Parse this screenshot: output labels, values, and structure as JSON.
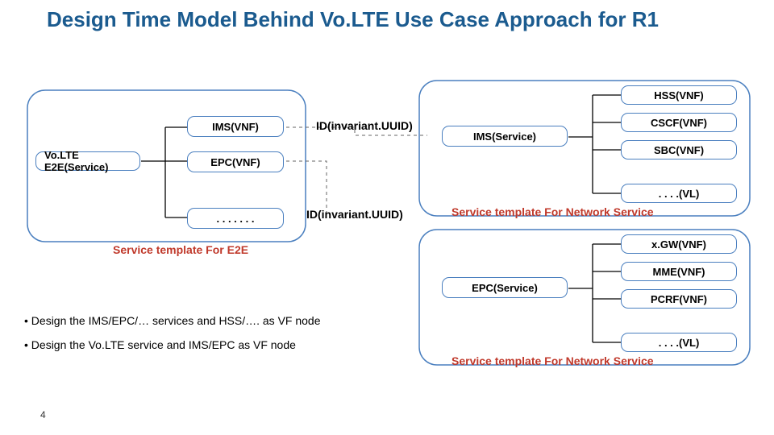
{
  "title": "Design Time Model Behind Vo.LTE Use Case Approach for R1",
  "left": {
    "volte": "Vo.LTE E2E(Service)",
    "ims_vnf": "IMS(VNF)",
    "epc_vnf": "EPC(VNF)",
    "dots": ". . . . . . .",
    "tmpl_e2e": "Service template For E2E"
  },
  "mid": {
    "id1": "ID(invariant.UUID)",
    "ims_service": "IMS(Service)",
    "id2": "ID(invariant.UUID)",
    "epc_service": "EPC(Service)"
  },
  "right_ims": {
    "hss": "HSS(VNF)",
    "cscf": "CSCF(VNF)",
    "sbc": "SBC(VNF)",
    "vl": ". . . .(VL)",
    "tmpl": "Service template For Network Service"
  },
  "right_epc": {
    "xgw": "x.GW(VNF)",
    "mme": "MME(VNF)",
    "pcrf": "PCRF(VNF)",
    "vl": ". . . .(VL)",
    "tmpl": "Service template For Network Service"
  },
  "bullets": {
    "b1": "•  Design the IMS/EPC/… services and HSS/…. as VF node",
    "b2": "•  Design the Vo.LTE service and IMS/EPC as VF node"
  },
  "page": "4"
}
